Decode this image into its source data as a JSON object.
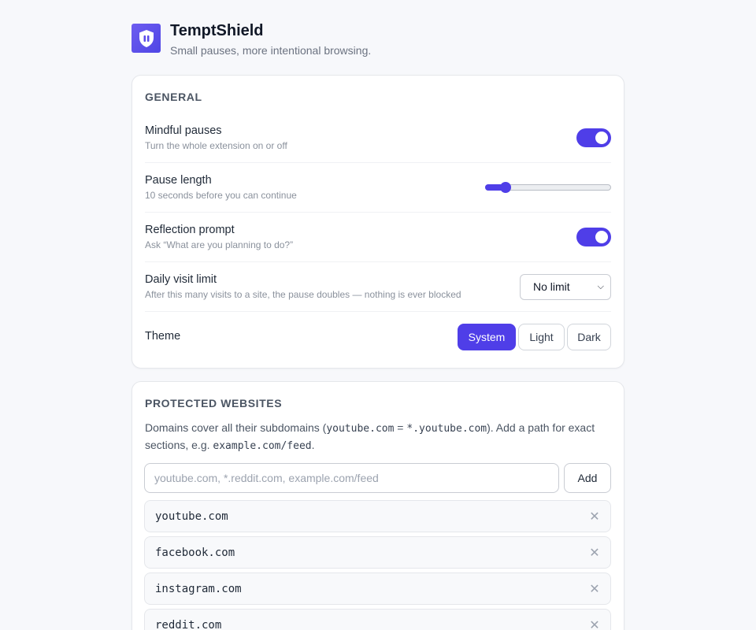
{
  "app": {
    "title": "TemptShield",
    "subtitle": "Small pauses, more intentional browsing."
  },
  "general": {
    "section_title": "GENERAL",
    "mindful": {
      "label": "Mindful pauses",
      "desc": "Turn the whole extension on or off",
      "enabled": true
    },
    "pause_length": {
      "label": "Pause length",
      "desc": "10 seconds before you can continue",
      "value_seconds": 10,
      "level_fraction": 0.16
    },
    "reflection": {
      "label": "Reflection prompt",
      "desc": "Ask “What are you planning to do?”",
      "enabled": true
    },
    "daily_limit": {
      "label": "Daily visit limit",
      "desc": "After this many visits to a site, the pause doubles — nothing is ever blocked",
      "selected": "No limit"
    },
    "theme": {
      "label": "Theme",
      "options": [
        "System",
        "Light",
        "Dark"
      ],
      "selected": "System"
    }
  },
  "sites": {
    "section_title": "PROTECTED WEBSITES",
    "desc_a": "Domains cover all their subdomains (",
    "code_a": "youtube.com",
    "eq": " = ",
    "code_b": "*.youtube.com",
    "desc_b": "). Add a path for exact sections, e.g. ",
    "code_c": "example.com/feed",
    "desc_c": ".",
    "input_placeholder": "youtube.com, *.reddit.com, example.com/feed",
    "add_label": "Add",
    "list": [
      "youtube.com",
      "facebook.com",
      "instagram.com",
      "reddit.com"
    ],
    "remove_glyph": "✕"
  },
  "colors": {
    "accent": "#4f3ee8",
    "background": "#f7f8fb"
  }
}
